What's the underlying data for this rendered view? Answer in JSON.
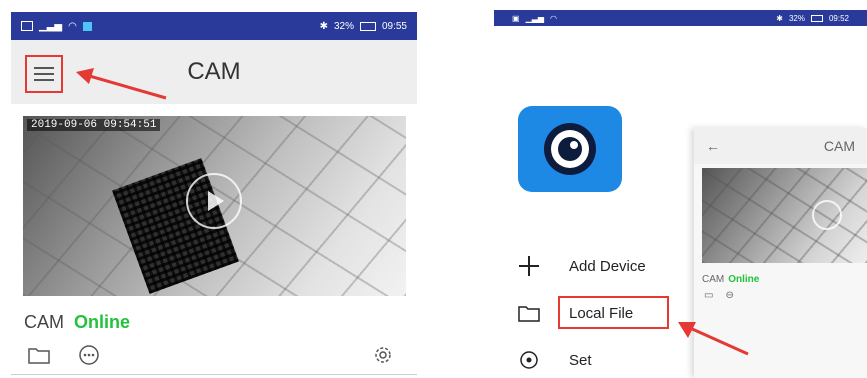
{
  "left_phone": {
    "status_time": "09:55",
    "status_battery": "32%",
    "header_title": "CAM",
    "video_timestamp": "2019-09-06 09:54:51",
    "device_name": "CAM",
    "device_status": "Online"
  },
  "right_phone": {
    "status_time": "09:52",
    "status_battery": "32%",
    "menu": {
      "add_device": "Add Device",
      "local_file": "Local File",
      "set": "Set"
    },
    "mini": {
      "title": "CAM",
      "device_name": "CAM",
      "device_status": "Online"
    }
  },
  "colors": {
    "status_bar": "#2a3a9a",
    "online": "#22c23a",
    "annotation_red": "#e53935",
    "app_blue": "#1e88e5"
  },
  "icons": [
    "menu-icon",
    "play-icon",
    "folder-icon",
    "message-icon",
    "gear-icon",
    "plus-icon",
    "set-icon",
    "back-arrow-icon",
    "eye-logo-icon"
  ]
}
